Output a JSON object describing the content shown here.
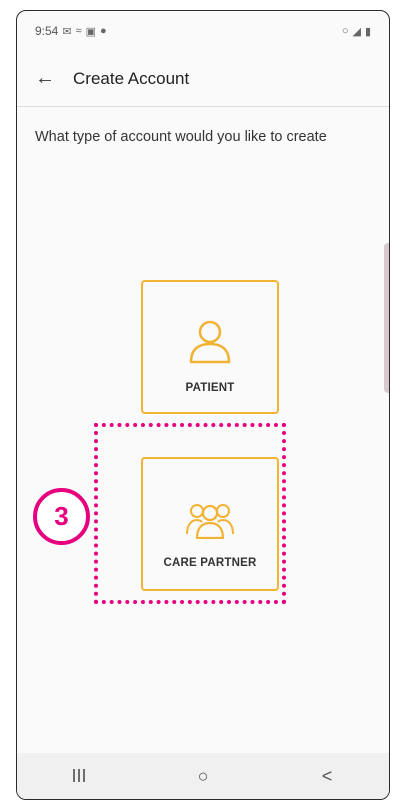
{
  "status_bar": {
    "time": "9:54",
    "left_icons": [
      "message-icon",
      "wifi-icon",
      "image-icon",
      "lock-icon"
    ],
    "right_icons": [
      "alarm-icon",
      "signal-icon",
      "battery-icon"
    ]
  },
  "app_bar": {
    "back_icon": "←",
    "title": "Create Account"
  },
  "prompt": "What type of account would you like to create",
  "options": [
    {
      "label": "PATIENT",
      "icon": "person-icon"
    },
    {
      "label": "CARE PARTNER",
      "icon": "group-icon"
    }
  ],
  "annotation": {
    "step": "3"
  },
  "nav_bar": {
    "recents": "III",
    "home": "○",
    "back": "<"
  },
  "colors": {
    "accent": "#f2b233",
    "annotation": "#e6007e"
  }
}
